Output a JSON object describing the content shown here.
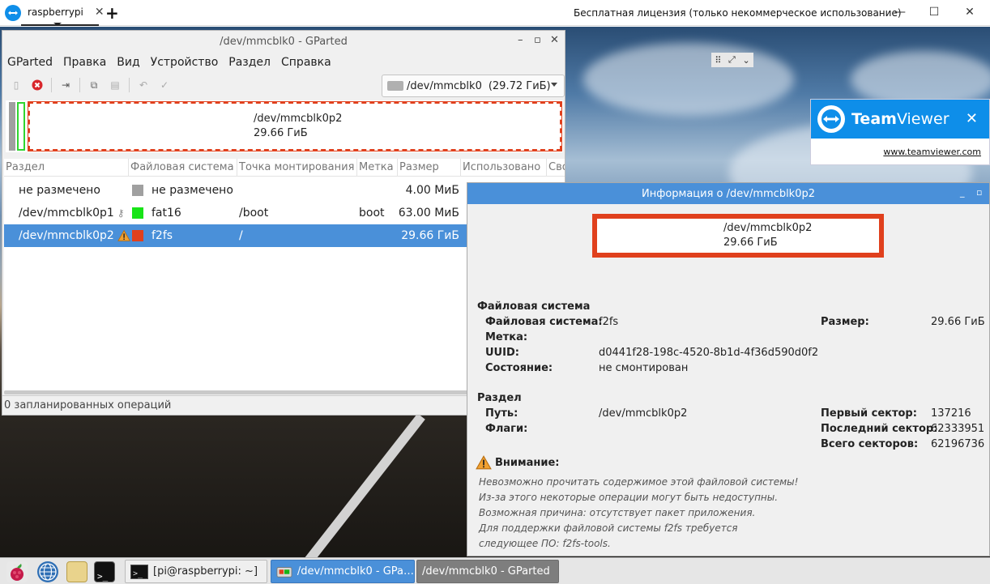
{
  "teamviewer": {
    "tab_label": "raspberrypi",
    "tab_close": "✕",
    "add_tab": "+",
    "license_text": "Бесплатная лицензия (только некоммерческое использование)",
    "popup_brand_bold": "Team",
    "popup_brand_rest": "Viewer",
    "popup_link": "www.teamviewer.com",
    "popup_close": "✕",
    "accent": "#0e8ee9"
  },
  "gparted": {
    "title": "/dev/mmcblk0 - GParted",
    "menu": [
      "GParted",
      "Правка",
      "Вид",
      "Устройство",
      "Раздел",
      "Справка"
    ],
    "device_name": "/dev/mmcblk0",
    "device_size": "(29.72 ГиБ)",
    "disk_map": {
      "partition": "/dev/mmcblk0p2",
      "size": "29.66 ГиБ"
    },
    "columns": [
      "Раздел",
      "Файловая система",
      "Точка монтирования",
      "Метка",
      "Размер",
      "Использовано",
      "Сво"
    ],
    "rows": [
      {
        "partition": "не размечено",
        "fs": "не размечено",
        "mount": "",
        "label": "",
        "size": "4.00 МиБ",
        "used": "---",
        "color": "#a0a0a0"
      },
      {
        "partition": "/dev/mmcblk0p1",
        "fs": "fat16",
        "mount": "/boot",
        "label": "boot",
        "size": "63.00 МиБ",
        "used": "",
        "color": "#18e418"
      },
      {
        "partition": "/dev/mmcblk0p2",
        "fs": "f2fs",
        "mount": "/",
        "label": "",
        "size": "29.66 ГиБ",
        "used": "",
        "color": "#e0401d"
      }
    ],
    "status": "0 запланированных операций"
  },
  "info": {
    "title": "Информация о /dev/mmcblk0p2",
    "map_partition": "/dev/mmcblk0p2",
    "map_size": "29.66 ГиБ",
    "fs_section": "Файловая система",
    "fs_label": "Файловая система:",
    "fs_value": "f2fs",
    "label_label": "Метка:",
    "uuid_label": "UUID:",
    "uuid_value": "d0441f28-198c-4520-8b1d-4f36d590d0f2",
    "state_label": "Состояние:",
    "state_value": "не смонтирован",
    "size_label": "Размер:",
    "size_value": "29.66 ГиБ",
    "part_section": "Раздел",
    "path_label": "Путь:",
    "path_value": "/dev/mmcblk0p2",
    "flags_label": "Флаги:",
    "first_label": "Первый сектор:",
    "first_value": "137216",
    "last_label": "Последний сектор:",
    "last_value": "62333951",
    "total_label": "Всего секторов:",
    "total_value": "62196736",
    "warning_title": "Внимание:",
    "warning_lines": [
      "Невозможно прочитать содержимое этой файловой системы!",
      "Из-за этого некоторые операции могут быть недоступны.",
      "Возможная причина: отсутствует пакет приложения.",
      "Для поддержки файловой системы f2fs требуется",
      "следующее ПО: f2fs-tools."
    ]
  },
  "taskbar": {
    "terminal_task": "[pi@raspberrypi: ~]",
    "gparted_task": "/dev/mmcblk0 - GPa…",
    "gparted_task_hover": "/dev/mmcblk0 - GParted"
  }
}
